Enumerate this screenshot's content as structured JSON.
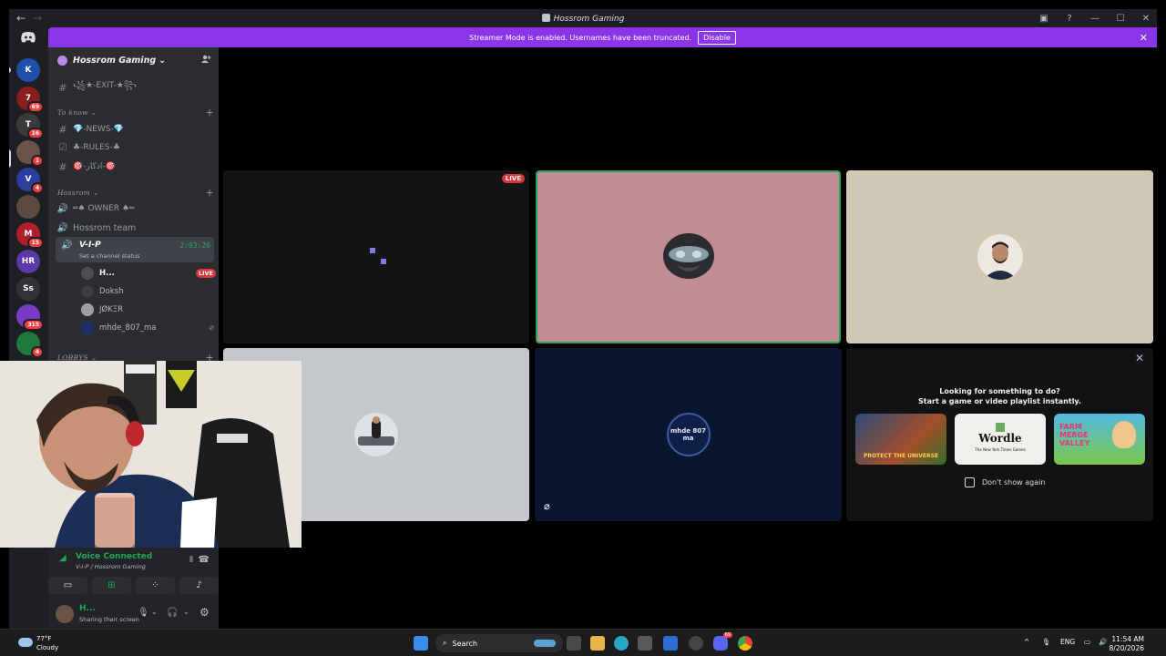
{
  "window": {
    "title": "Hossrom Gaming",
    "back_glyph": "←",
    "forward_glyph": "→",
    "inbox_glyph": "▣",
    "help_glyph": "?",
    "minimize_glyph": "—",
    "maximize_glyph": "☐",
    "close_glyph": "✕"
  },
  "banner": {
    "text": "Streamer Mode is enabled. Usernames have been truncated.",
    "disable_label": "Disable",
    "close_glyph": "✕",
    "color": "#8a35e8"
  },
  "servers": [
    {
      "initials": "K",
      "badge": "",
      "color": "#1f4fa8"
    },
    {
      "initials": "7",
      "badge": "69",
      "color": "#8a1d1d"
    },
    {
      "initials": "T",
      "badge": "16",
      "color": "#3a3a3a"
    },
    {
      "initials": "",
      "badge": "1",
      "color": "#6b5447"
    },
    {
      "initials": "V",
      "badge": "4",
      "color": "#2b3f9e"
    },
    {
      "initials": "",
      "badge": "",
      "color": "#5a4a42"
    },
    {
      "initials": "M",
      "badge": "15",
      "color": "#b01e2b"
    },
    {
      "initials": "HR",
      "badge": "",
      "color": "#5b3aa8"
    },
    {
      "initials": "Ss",
      "badge": "",
      "color": "#313338"
    },
    {
      "initials": "",
      "badge": "315",
      "color": "#7a3ac8"
    },
    {
      "initials": "",
      "badge": "4",
      "color": "#1e7a3a"
    }
  ],
  "guild": {
    "name": "Hossrom Gaming",
    "chevron": "⌄",
    "invite_glyph": "⁺"
  },
  "channels": {
    "exit": "꧁★-EXIT-★꧂",
    "cat_to_know": "To know",
    "news": "💎-NEWS-💎",
    "rules": "♣-RULES-♣",
    "azkar": "🎯-اذكار-🎯",
    "cat_hossrom": "Hossrom",
    "owner": "═♠ OWNER ♠═",
    "team": "Hossrom team",
    "vip": "V-I-P",
    "vip_status": "Set a channel status",
    "vip_time": "2:03:26",
    "cat_lobbys": "LOBBYS",
    "plus": "+"
  },
  "members": [
    {
      "name": "H...",
      "live": "LIVE",
      "color": "#4a4f55"
    },
    {
      "name": "Doksh",
      "color": "#3a3f47"
    },
    {
      "name": "JØKΞR",
      "color": "#9aa0a8"
    },
    {
      "name": "mhde_807_ma",
      "mute_glyph": "⌀",
      "color": "#1c2f6a"
    }
  ],
  "voice": {
    "title": "Voice Connected",
    "subtitle": "V-I-P / Hossrom Gaming",
    "buttons": [
      "▭",
      "⊞",
      "⁘",
      "♪"
    ]
  },
  "user": {
    "name": "H...",
    "status": "Sharing their screen",
    "mic_glyph": "🎙",
    "headset_glyph": "🎧",
    "settings_glyph": "⚙",
    "caret": "⌄"
  },
  "stage": {
    "live_label": "LIVE",
    "tiles": [
      {
        "id": "screen",
        "bg": "#141416"
      },
      {
        "id": "helmet",
        "bg": "#c08d94",
        "speaking": true
      },
      {
        "id": "man",
        "bg": "#d1c7b5"
      },
      {
        "id": "car",
        "bg": "#c4c8cc"
      },
      {
        "id": "mhde",
        "bg": "#0a1630",
        "avatar_text": "mhde 807 ma",
        "mute_glyph": "⌀"
      }
    ]
  },
  "activity": {
    "line1": "Looking for something to do?",
    "line2": "Start a game or video playlist instantly.",
    "close_glyph": "✕",
    "cards": [
      {
        "label": "PROTECT THE UNIVERSE",
        "bg": "#6a3a2a"
      },
      {
        "label": "Wordle",
        "sub": "The New York Times Games",
        "bg": "#f0efeb"
      },
      {
        "label": "FARM MERGE VALLEY",
        "bg": "#54b8e0"
      }
    ],
    "dont_show": "Don't show again"
  },
  "taskbar": {
    "temp": "77°F",
    "condition": "Cloudy",
    "search": "Search",
    "lang": "ENG",
    "time": "11:54 AM",
    "date": "8/20/2026",
    "chevron_up": "^",
    "discord_badge": "69"
  }
}
